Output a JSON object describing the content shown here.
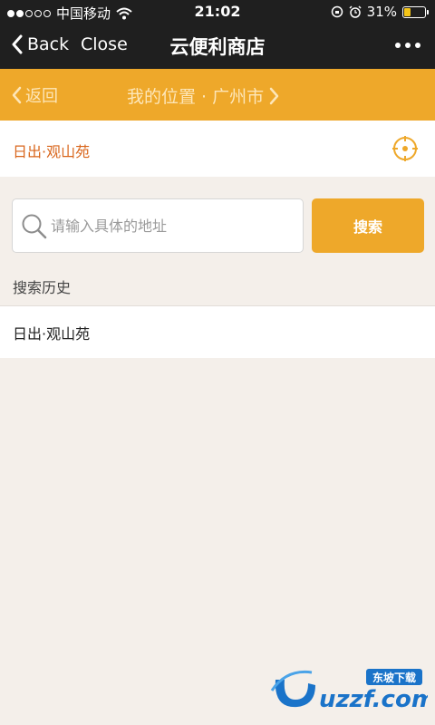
{
  "status_bar": {
    "carrier": "中国移动",
    "time": "21:02",
    "battery": "31%",
    "battery_level": 0.31
  },
  "nav": {
    "back_label": "Back",
    "close_label": "Close",
    "title": "云便利商店"
  },
  "location_bar": {
    "back_label": "返回",
    "title": "我的位置 · 广州市"
  },
  "current_location": {
    "text": "日出·观山苑"
  },
  "search": {
    "placeholder": "请输入具体的地址",
    "value": "",
    "button_label": "搜索"
  },
  "history": {
    "label": "搜索历史",
    "items": [
      "日出·观山苑"
    ]
  },
  "watermark": {
    "brand": "uzzf.com",
    "tagline": "东坡下载"
  },
  "colors": {
    "accent": "#eea82a",
    "current_location_text": "#d9661c",
    "nav_background": "#1f1f1f",
    "page_background": "#f4efea"
  }
}
